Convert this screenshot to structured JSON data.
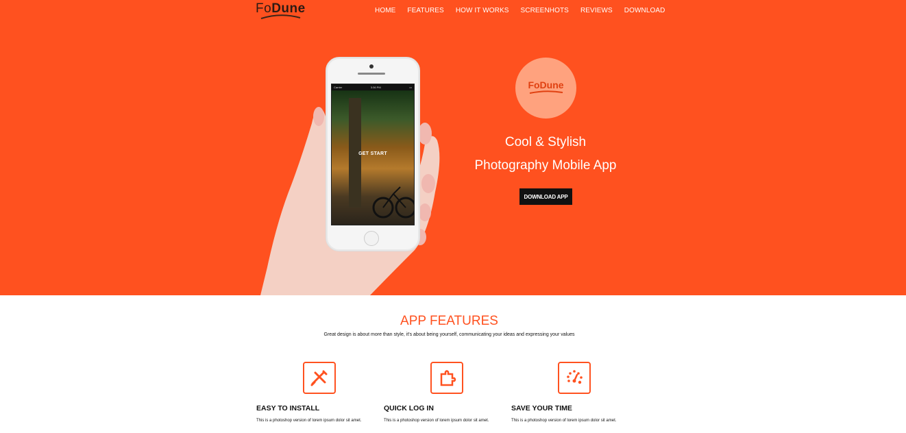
{
  "brand": {
    "logo_fo": "Fo",
    "logo_dune": "Dune",
    "badge_logo": "FoDune"
  },
  "nav": [
    "HOME",
    "FEATURES",
    "HOW IT WORKS",
    "SCREENHOTS",
    "REVIEWS",
    "DOWNLOAD"
  ],
  "phone": {
    "carrier": "Carrier",
    "time": "3:36 PM",
    "screen_cta": "GET START"
  },
  "hero": {
    "title_line1": "Cool & Stylish",
    "title_line2": "Photography Mobile App",
    "download_label": "DOWNLOAD APP"
  },
  "features": {
    "title": "APP FEATURES",
    "subtitle": "Great design is about more than style, it's about being yourself, communicating your ideas and expressing your values",
    "items": [
      {
        "icon": "tools-icon",
        "title": "EASY TO INSTALL",
        "text": "This is a photoshop version of lorem ipsum dolor sit amet."
      },
      {
        "icon": "puzzle-icon",
        "title": "QUICK LOG IN",
        "text": "This is a photoshop version of lorem ipsum dolor sit amet."
      },
      {
        "icon": "gauge-icon",
        "title": "SAVE YOUR TIME",
        "text": "This is a photoshop version of lorem ipsum dolor sit amet."
      }
    ]
  },
  "colors": {
    "accent": "#ff511f",
    "badge": "#ffa27e",
    "dark": "#111111"
  }
}
